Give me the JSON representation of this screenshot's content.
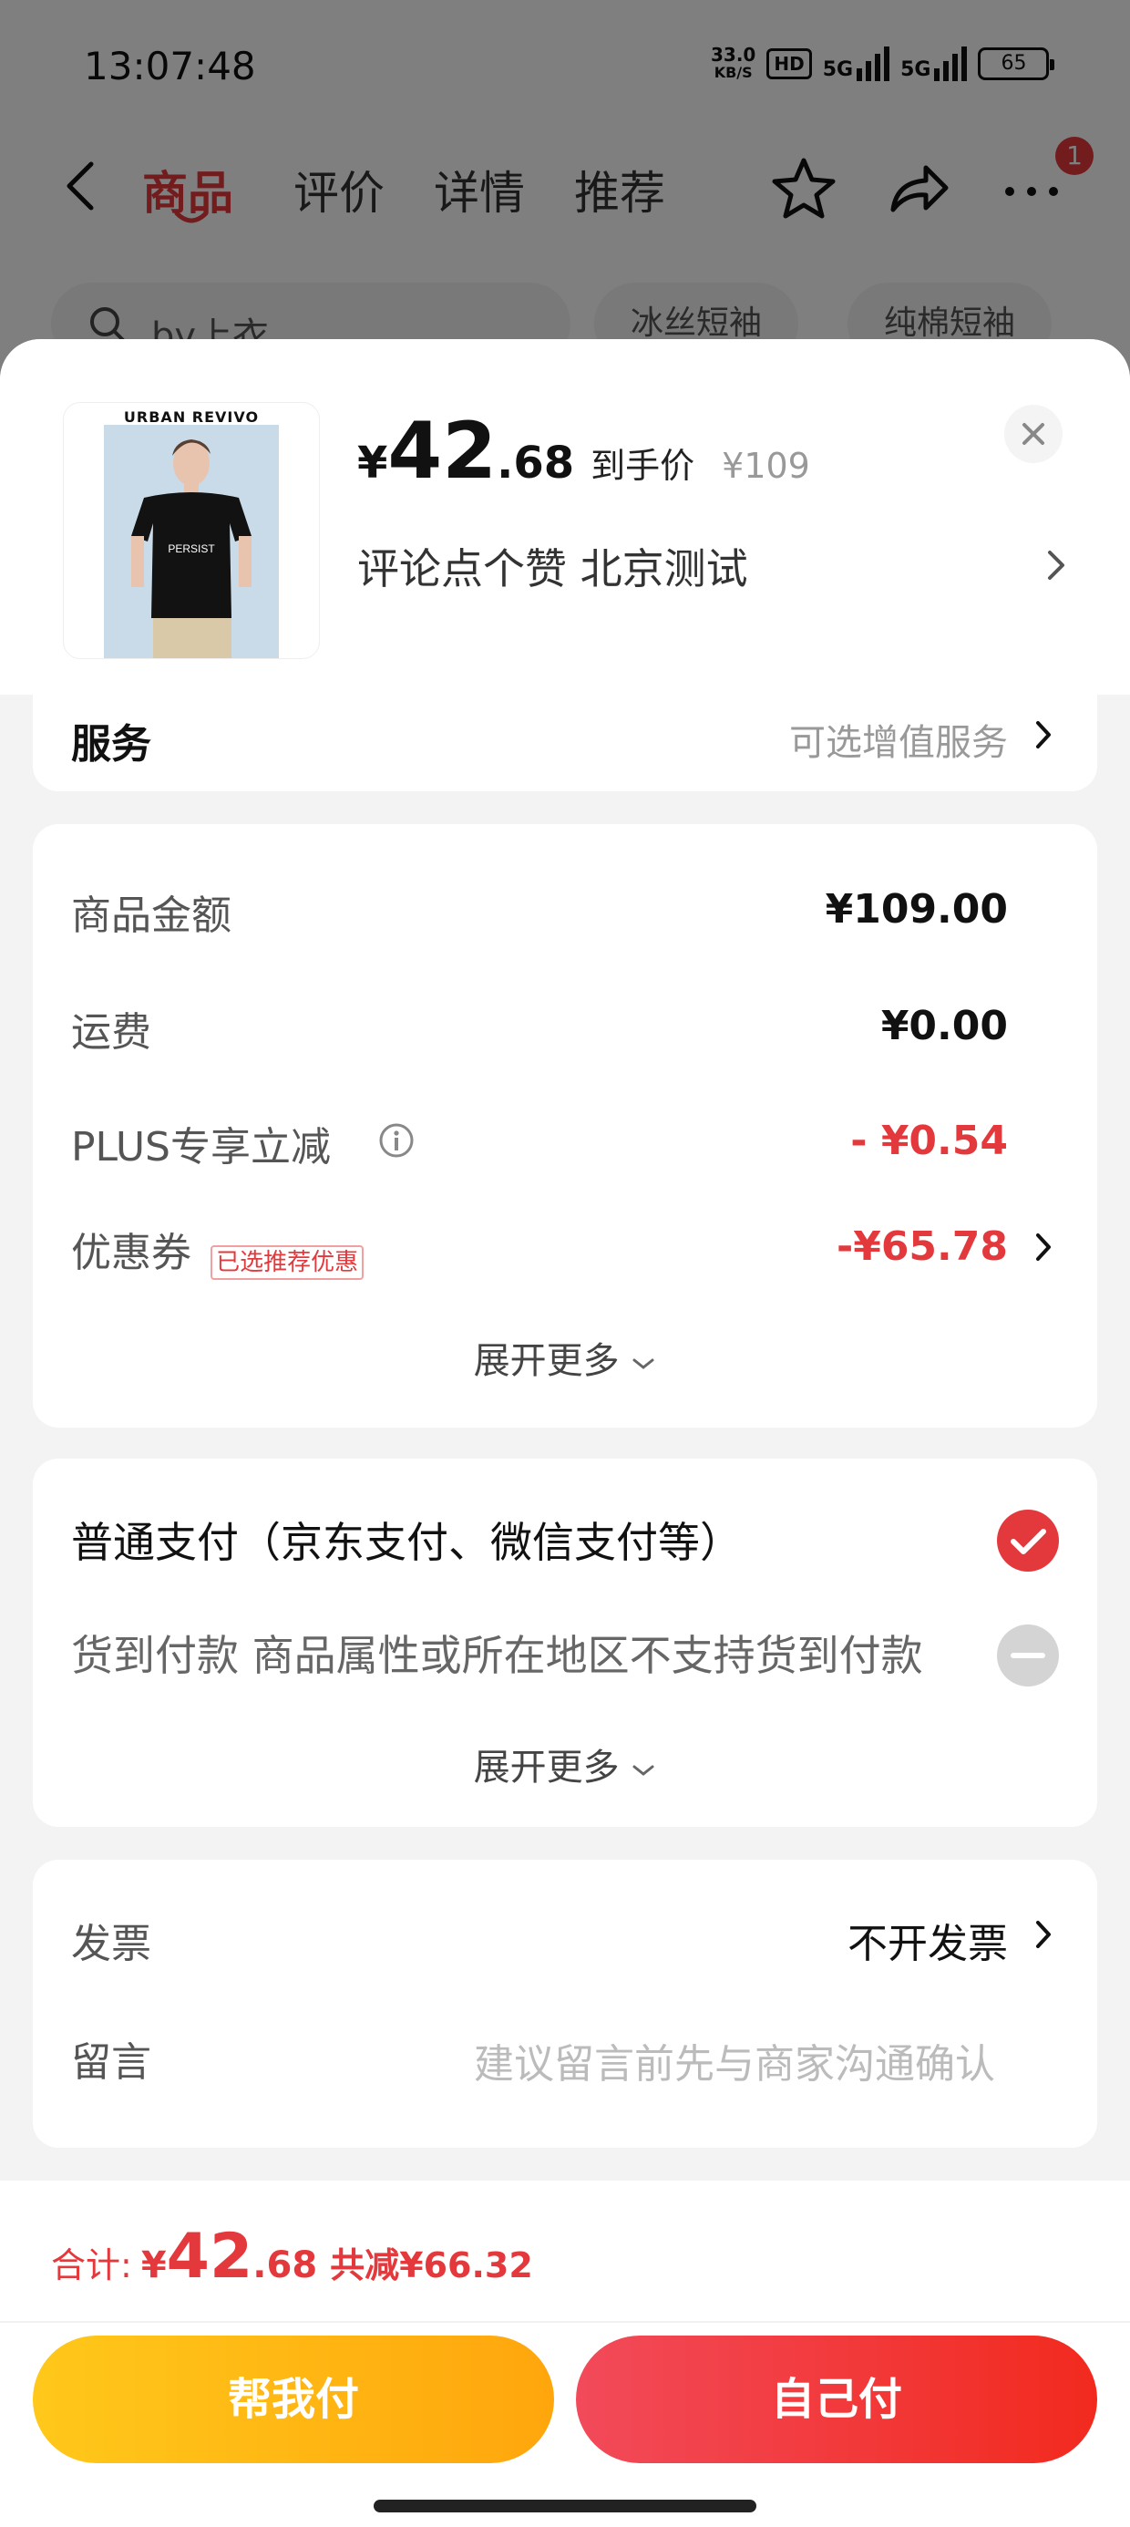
{
  "status_bar": {
    "time": "13:07:48",
    "net_speed_value": "33.0",
    "net_speed_unit": "KB/S",
    "hd": "HD",
    "signal_1": "5G",
    "signal_2": "5G",
    "battery": "65"
  },
  "nav": {
    "tabs": [
      {
        "label": "商品",
        "active": true
      },
      {
        "label": "评价",
        "active": false
      },
      {
        "label": "详情",
        "active": false
      },
      {
        "label": "推荐",
        "active": false
      }
    ],
    "message_badge": "1"
  },
  "search": {
    "text": "by上衣",
    "chips": [
      "冰丝短袖",
      "纯棉短袖"
    ]
  },
  "product": {
    "brand": "URBAN REVIVO",
    "shirt_print": "PERSIST",
    "price_currency": "¥",
    "price_integer": "42",
    "price_decimal": ".68",
    "price_label": "到手价",
    "original_price": "¥109",
    "spec": "评论点个赞  北京测试"
  },
  "service": {
    "label": "服务",
    "value": "可选增值服务"
  },
  "price_detail": {
    "rows": [
      {
        "label": "商品金额",
        "value": "¥109.00"
      },
      {
        "label": "运费",
        "value": "¥0.00"
      },
      {
        "label": "PLUS专享立减",
        "value": "- ¥0.54"
      },
      {
        "label": "优惠券",
        "value": "-¥65.78",
        "tag": "已选推荐优惠"
      }
    ],
    "expand_label": "展开更多"
  },
  "payment": {
    "option_normal": "普通支付（京东支付、微信支付等）",
    "option_cod": "货到付款 商品属性或所在地区不支持货到付款",
    "expand_label": "展开更多"
  },
  "invoice": {
    "label": "发票",
    "value": "不开发票"
  },
  "note": {
    "label": "留言",
    "placeholder": "建议留言前先与商家沟通确认"
  },
  "footer": {
    "total_label": "合计:",
    "total_currency": "¥",
    "total_integer": "42",
    "total_decimal": ".68",
    "saved": "共减¥66.32",
    "help_pay": "帮我付",
    "self_pay": "自己付"
  },
  "colors": {
    "accent_red": "#e4393c",
    "help_pay_gradient": [
      "#ffc81a",
      "#ffa60d"
    ],
    "self_pay_gradient": [
      "#f24a5a",
      "#f22a1e"
    ]
  }
}
